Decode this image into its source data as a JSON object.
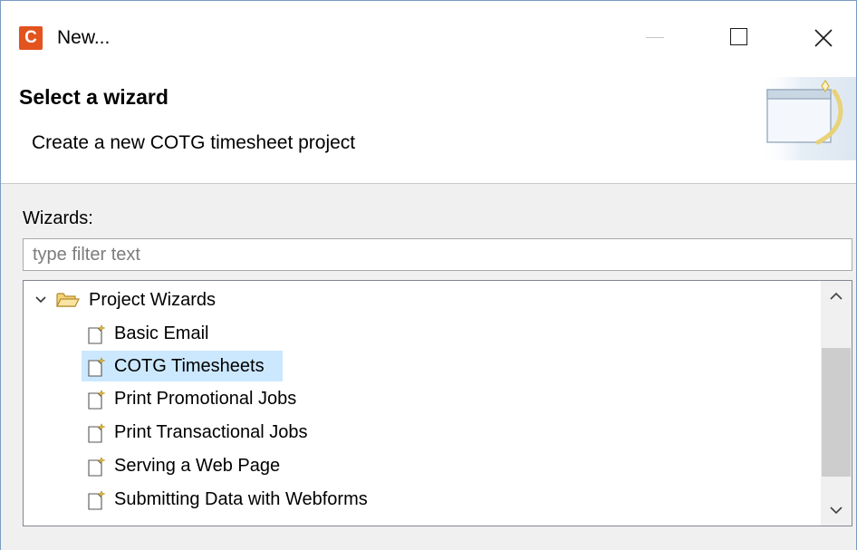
{
  "window": {
    "title": "New...",
    "app_icon_letter": "C",
    "app_icon_color": "#e3531e"
  },
  "banner": {
    "title": "Select a wizard",
    "description": "Create a new COTG timesheet project",
    "icon": "wizard-banner-icon"
  },
  "wizards": {
    "label": "Wizards:",
    "filter_placeholder": "type filter text",
    "filter_value": ""
  },
  "tree": {
    "folder": {
      "label": "Project Wizards",
      "expanded": true,
      "icon": "open-folder-icon"
    },
    "items": [
      {
        "label": "Basic Email",
        "selected": false
      },
      {
        "label": "COTG Timesheets",
        "selected": true
      },
      {
        "label": "Print Promotional Jobs",
        "selected": false
      },
      {
        "label": "Print Transactional Jobs",
        "selected": false
      },
      {
        "label": "Serving a Web Page",
        "selected": false
      },
      {
        "label": "Submitting Data with Webforms",
        "selected": false
      }
    ],
    "selection_color": "#cce8ff"
  }
}
